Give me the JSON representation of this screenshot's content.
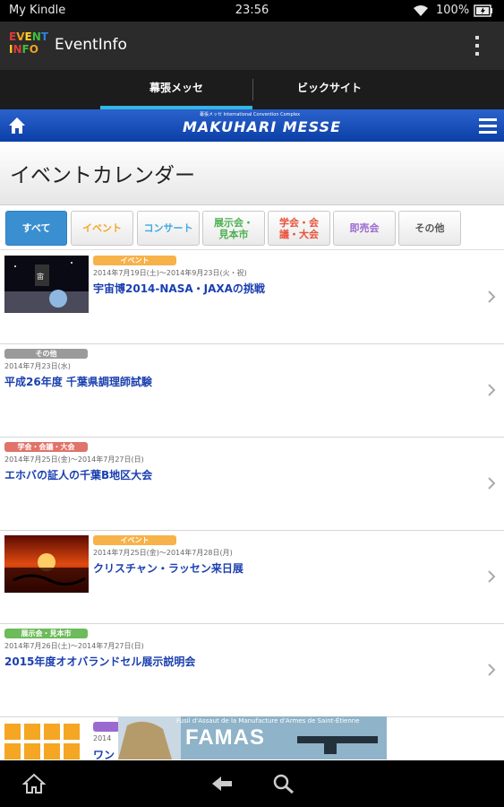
{
  "status_bar": {
    "carrier": "My Kindle",
    "time": "23:56",
    "battery": "100%",
    "wifi_icon": "wifi-icon",
    "battery_icon": "battery-icon"
  },
  "app_bar": {
    "logo_line1": "EVENT",
    "logo_line2": "INFO",
    "title": "EventInfo",
    "menu_icon": "overflow-menu-icon"
  },
  "tabs": [
    {
      "label": "幕張メッセ",
      "selected": true
    },
    {
      "label": "ビックサイト",
      "selected": false
    }
  ],
  "site_header": {
    "logo_sub": "幕張メッセ  International Convention Complex",
    "logo_main": "MAKUHARI MESSE",
    "home_icon": "home-icon",
    "menu_icon": "hamburger-icon"
  },
  "page_title": "イベントカレンダー",
  "filters": [
    {
      "label": "すべて",
      "color": "#ffffff",
      "active": true
    },
    {
      "label": "イベント",
      "color": "#f5a623",
      "active": false
    },
    {
      "label": "コンサート",
      "color": "#3fa9e0",
      "active": false
    },
    {
      "label": "展示会・見本市",
      "color": "#4caf50",
      "active": false
    },
    {
      "label": "学会・会議・大会",
      "color": "#e8523a",
      "active": false
    },
    {
      "label": "即売会",
      "color": "#9a6ad0",
      "active": false
    },
    {
      "label": "その他",
      "color": "#555555",
      "active": false
    }
  ],
  "events": [
    {
      "category": "イベント",
      "category_color": "#f7b24a",
      "date": "2014年7月19日(土)～2014年9月23日(火・祝)",
      "title": "宇宙博2014-NASA・JAXAの挑戦",
      "has_thumb": true
    },
    {
      "category": "その他",
      "category_color": "#9a9a9a",
      "date": "2014年7月23日(水)",
      "title": "平成26年度 千葉県調理師試験",
      "has_thumb": false
    },
    {
      "category": "学会・会議・大会",
      "category_color": "#e0736a",
      "date": "2014年7月25日(金)～2014年7月27日(日)",
      "title": "エホバの証人の千葉B地区大会",
      "has_thumb": false
    },
    {
      "category": "イベント",
      "category_color": "#f7b24a",
      "date": "2014年7月25日(金)～2014年7月28日(月)",
      "title": "クリスチャン・ラッセン来日展",
      "has_thumb": true
    },
    {
      "category": "展示会・見本市",
      "category_color": "#6dbb5a",
      "date": "2014年7月26日(土)～2014年7月27日(日)",
      "title": "2015年度オオバランドセル展示説明会",
      "has_thumb": false
    },
    {
      "category": "",
      "category_color": "#9a6ad0",
      "date": "2014",
      "title": "ワン",
      "has_thumb": true
    }
  ],
  "ad": {
    "headline": "FAMAS",
    "small": "Fusil d'Assaut de la Manufacture d'Armes de Saint-Étienne"
  },
  "nav_bar": {
    "home_icon": "home-icon",
    "back_icon": "back-arrow-icon",
    "search_icon": "search-icon"
  }
}
